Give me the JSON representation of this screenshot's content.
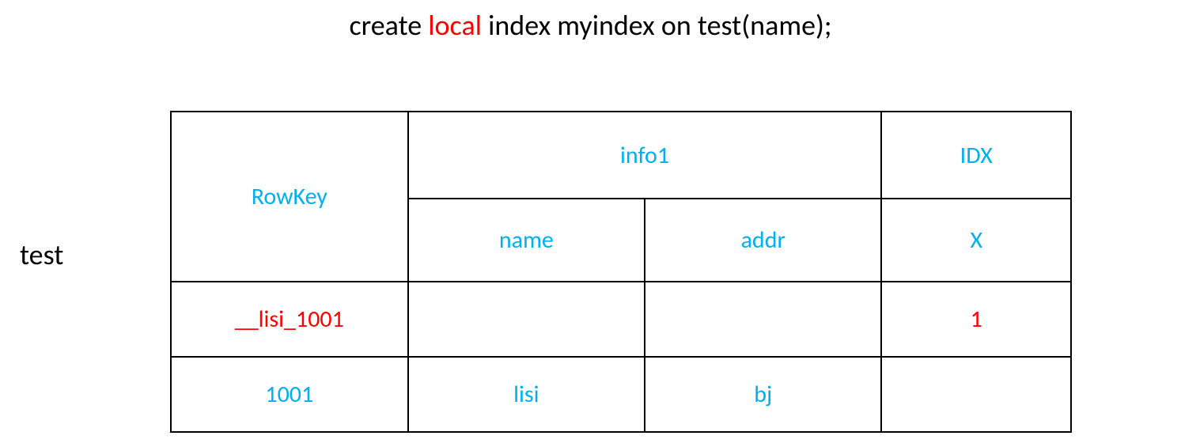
{
  "sql": {
    "pre": "create ",
    "keyword": "local",
    "post": " index myindex on test(name);"
  },
  "table_label": "test",
  "headers": {
    "rowkey": "RowKey",
    "info1": "info1",
    "idx": "IDX",
    "name": "name",
    "addr": "addr",
    "x": "X"
  },
  "rows": [
    {
      "rowkey": "__lisi_1001",
      "name": "",
      "addr": "",
      "x": "1",
      "rowkey_color": "red",
      "x_color": "red"
    },
    {
      "rowkey": "1001",
      "name": "lisi",
      "addr": "bj",
      "x": "",
      "rowkey_color": "blue",
      "name_color": "blue",
      "addr_color": "blue"
    }
  ],
  "chart_data": {
    "type": "table",
    "title": "create local index myindex on test(name);",
    "table_name": "test",
    "column_groups": [
      {
        "name": "RowKey",
        "columns": [
          "RowKey"
        ]
      },
      {
        "name": "info1",
        "columns": [
          "name",
          "addr"
        ]
      },
      {
        "name": "IDX",
        "columns": [
          "X"
        ]
      }
    ],
    "columns": [
      "RowKey",
      "name",
      "addr",
      "X"
    ],
    "rows": [
      {
        "RowKey": "__lisi_1001",
        "name": "",
        "addr": "",
        "X": "1"
      },
      {
        "RowKey": "1001",
        "name": "lisi",
        "addr": "bj",
        "X": ""
      }
    ]
  }
}
